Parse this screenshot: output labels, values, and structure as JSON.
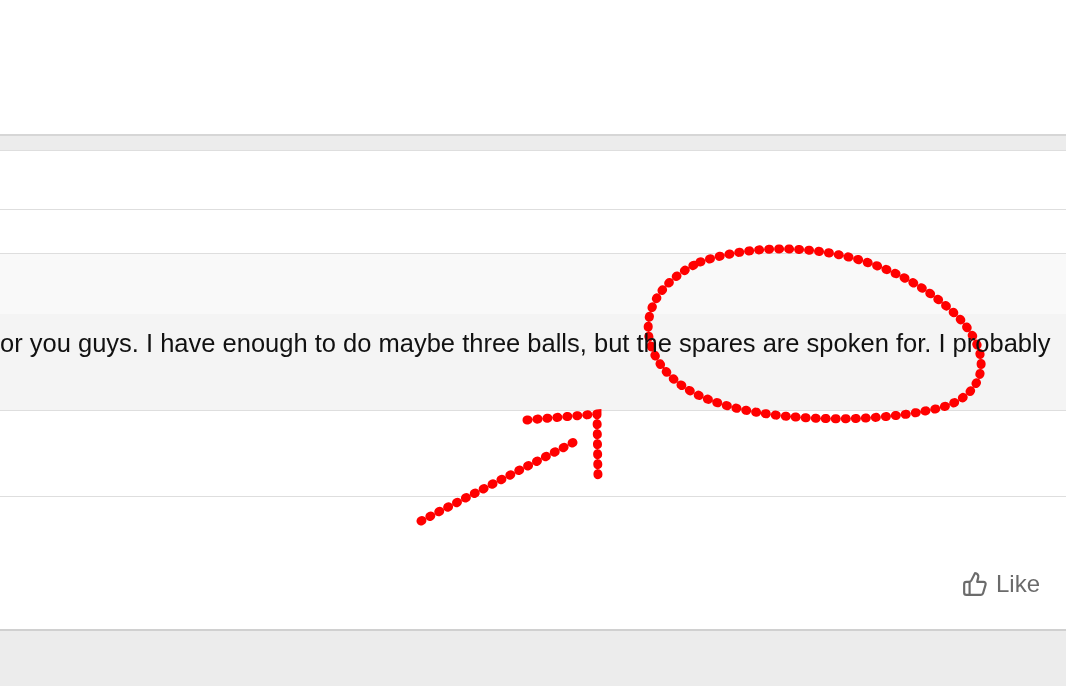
{
  "comment": {
    "text": "or you guys. I have enough to do maybe three balls, but the spares are spoken for. I probably"
  },
  "like_button": {
    "label": "Like"
  }
}
